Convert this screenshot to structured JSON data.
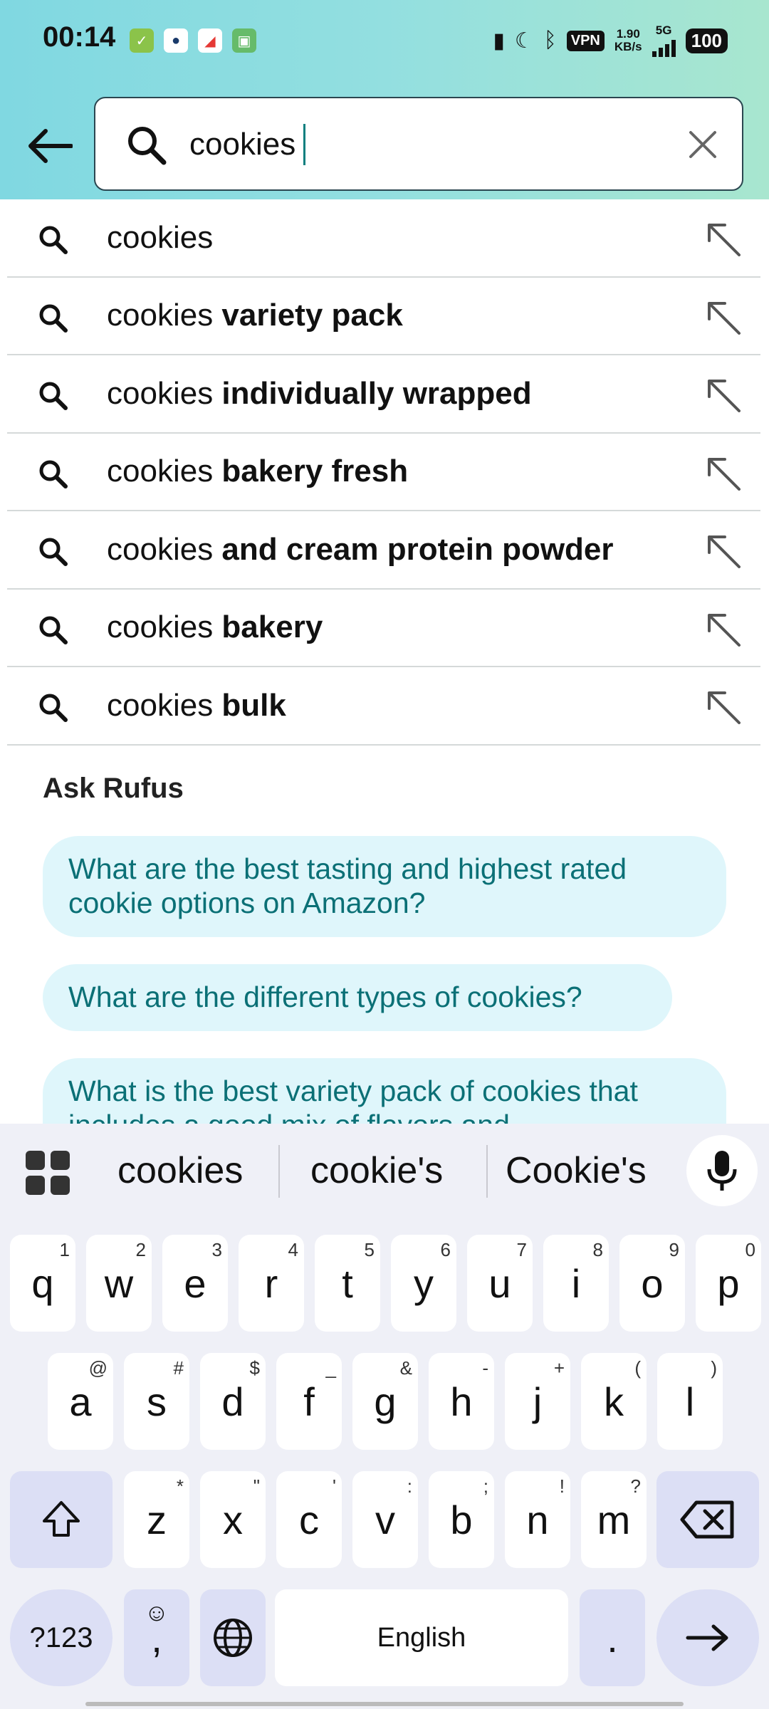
{
  "status_bar": {
    "time": "00:14",
    "vpn": "VPN",
    "speed_value": "1.90",
    "speed_unit": "KB/s",
    "network": "5G",
    "battery": "100"
  },
  "search": {
    "value": "cookies",
    "placeholder": ""
  },
  "suggestions": [
    {
      "prefix": "cookies",
      "bold": ""
    },
    {
      "prefix": "cookies ",
      "bold": "variety pack"
    },
    {
      "prefix": "cookies ",
      "bold": "individually wrapped"
    },
    {
      "prefix": "cookies ",
      "bold": "bakery fresh"
    },
    {
      "prefix": "cookies ",
      "bold": "and cream protein powder"
    },
    {
      "prefix": "cookies ",
      "bold": "bakery"
    },
    {
      "prefix": "cookies ",
      "bold": "bulk"
    }
  ],
  "rufus": {
    "title": "Ask Rufus",
    "questions": [
      "What are the best tasting and highest rated cookie options on Amazon?",
      "What are the different types of cookies?",
      "What is the best variety pack of cookies that includes a good mix of flavors and"
    ]
  },
  "keyboard": {
    "suggestions": [
      "cookies",
      "cookie's",
      "Cookie's"
    ],
    "row1": [
      {
        "k": "q",
        "h": "1"
      },
      {
        "k": "w",
        "h": "2"
      },
      {
        "k": "e",
        "h": "3"
      },
      {
        "k": "r",
        "h": "4"
      },
      {
        "k": "t",
        "h": "5"
      },
      {
        "k": "y",
        "h": "6"
      },
      {
        "k": "u",
        "h": "7"
      },
      {
        "k": "i",
        "h": "8"
      },
      {
        "k": "o",
        "h": "9"
      },
      {
        "k": "p",
        "h": "0"
      }
    ],
    "row2": [
      {
        "k": "a",
        "h": "@"
      },
      {
        "k": "s",
        "h": "#"
      },
      {
        "k": "d",
        "h": "$"
      },
      {
        "k": "f",
        "h": "_"
      },
      {
        "k": "g",
        "h": "&"
      },
      {
        "k": "h",
        "h": "-"
      },
      {
        "k": "j",
        "h": "+"
      },
      {
        "k": "k",
        "h": "("
      },
      {
        "k": "l",
        "h": ")"
      }
    ],
    "row3": [
      {
        "k": "z",
        "h": "*"
      },
      {
        "k": "x",
        "h": "\""
      },
      {
        "k": "c",
        "h": "'"
      },
      {
        "k": "v",
        "h": ":"
      },
      {
        "k": "b",
        "h": ";"
      },
      {
        "k": "n",
        "h": "!"
      },
      {
        "k": "m",
        "h": "?"
      }
    ],
    "symbols_label": "?123",
    "emoji_comma": ",",
    "space_label": "English",
    "period": "."
  },
  "colors": {
    "header_gradient_start": "#80d8e1",
    "header_gradient_end": "#a8e6cf",
    "rufus_pill_bg": "#dff6fb",
    "rufus_text": "#0b7076",
    "keyboard_bg": "#eff0f7",
    "modifier_key": "#dcdff5"
  }
}
